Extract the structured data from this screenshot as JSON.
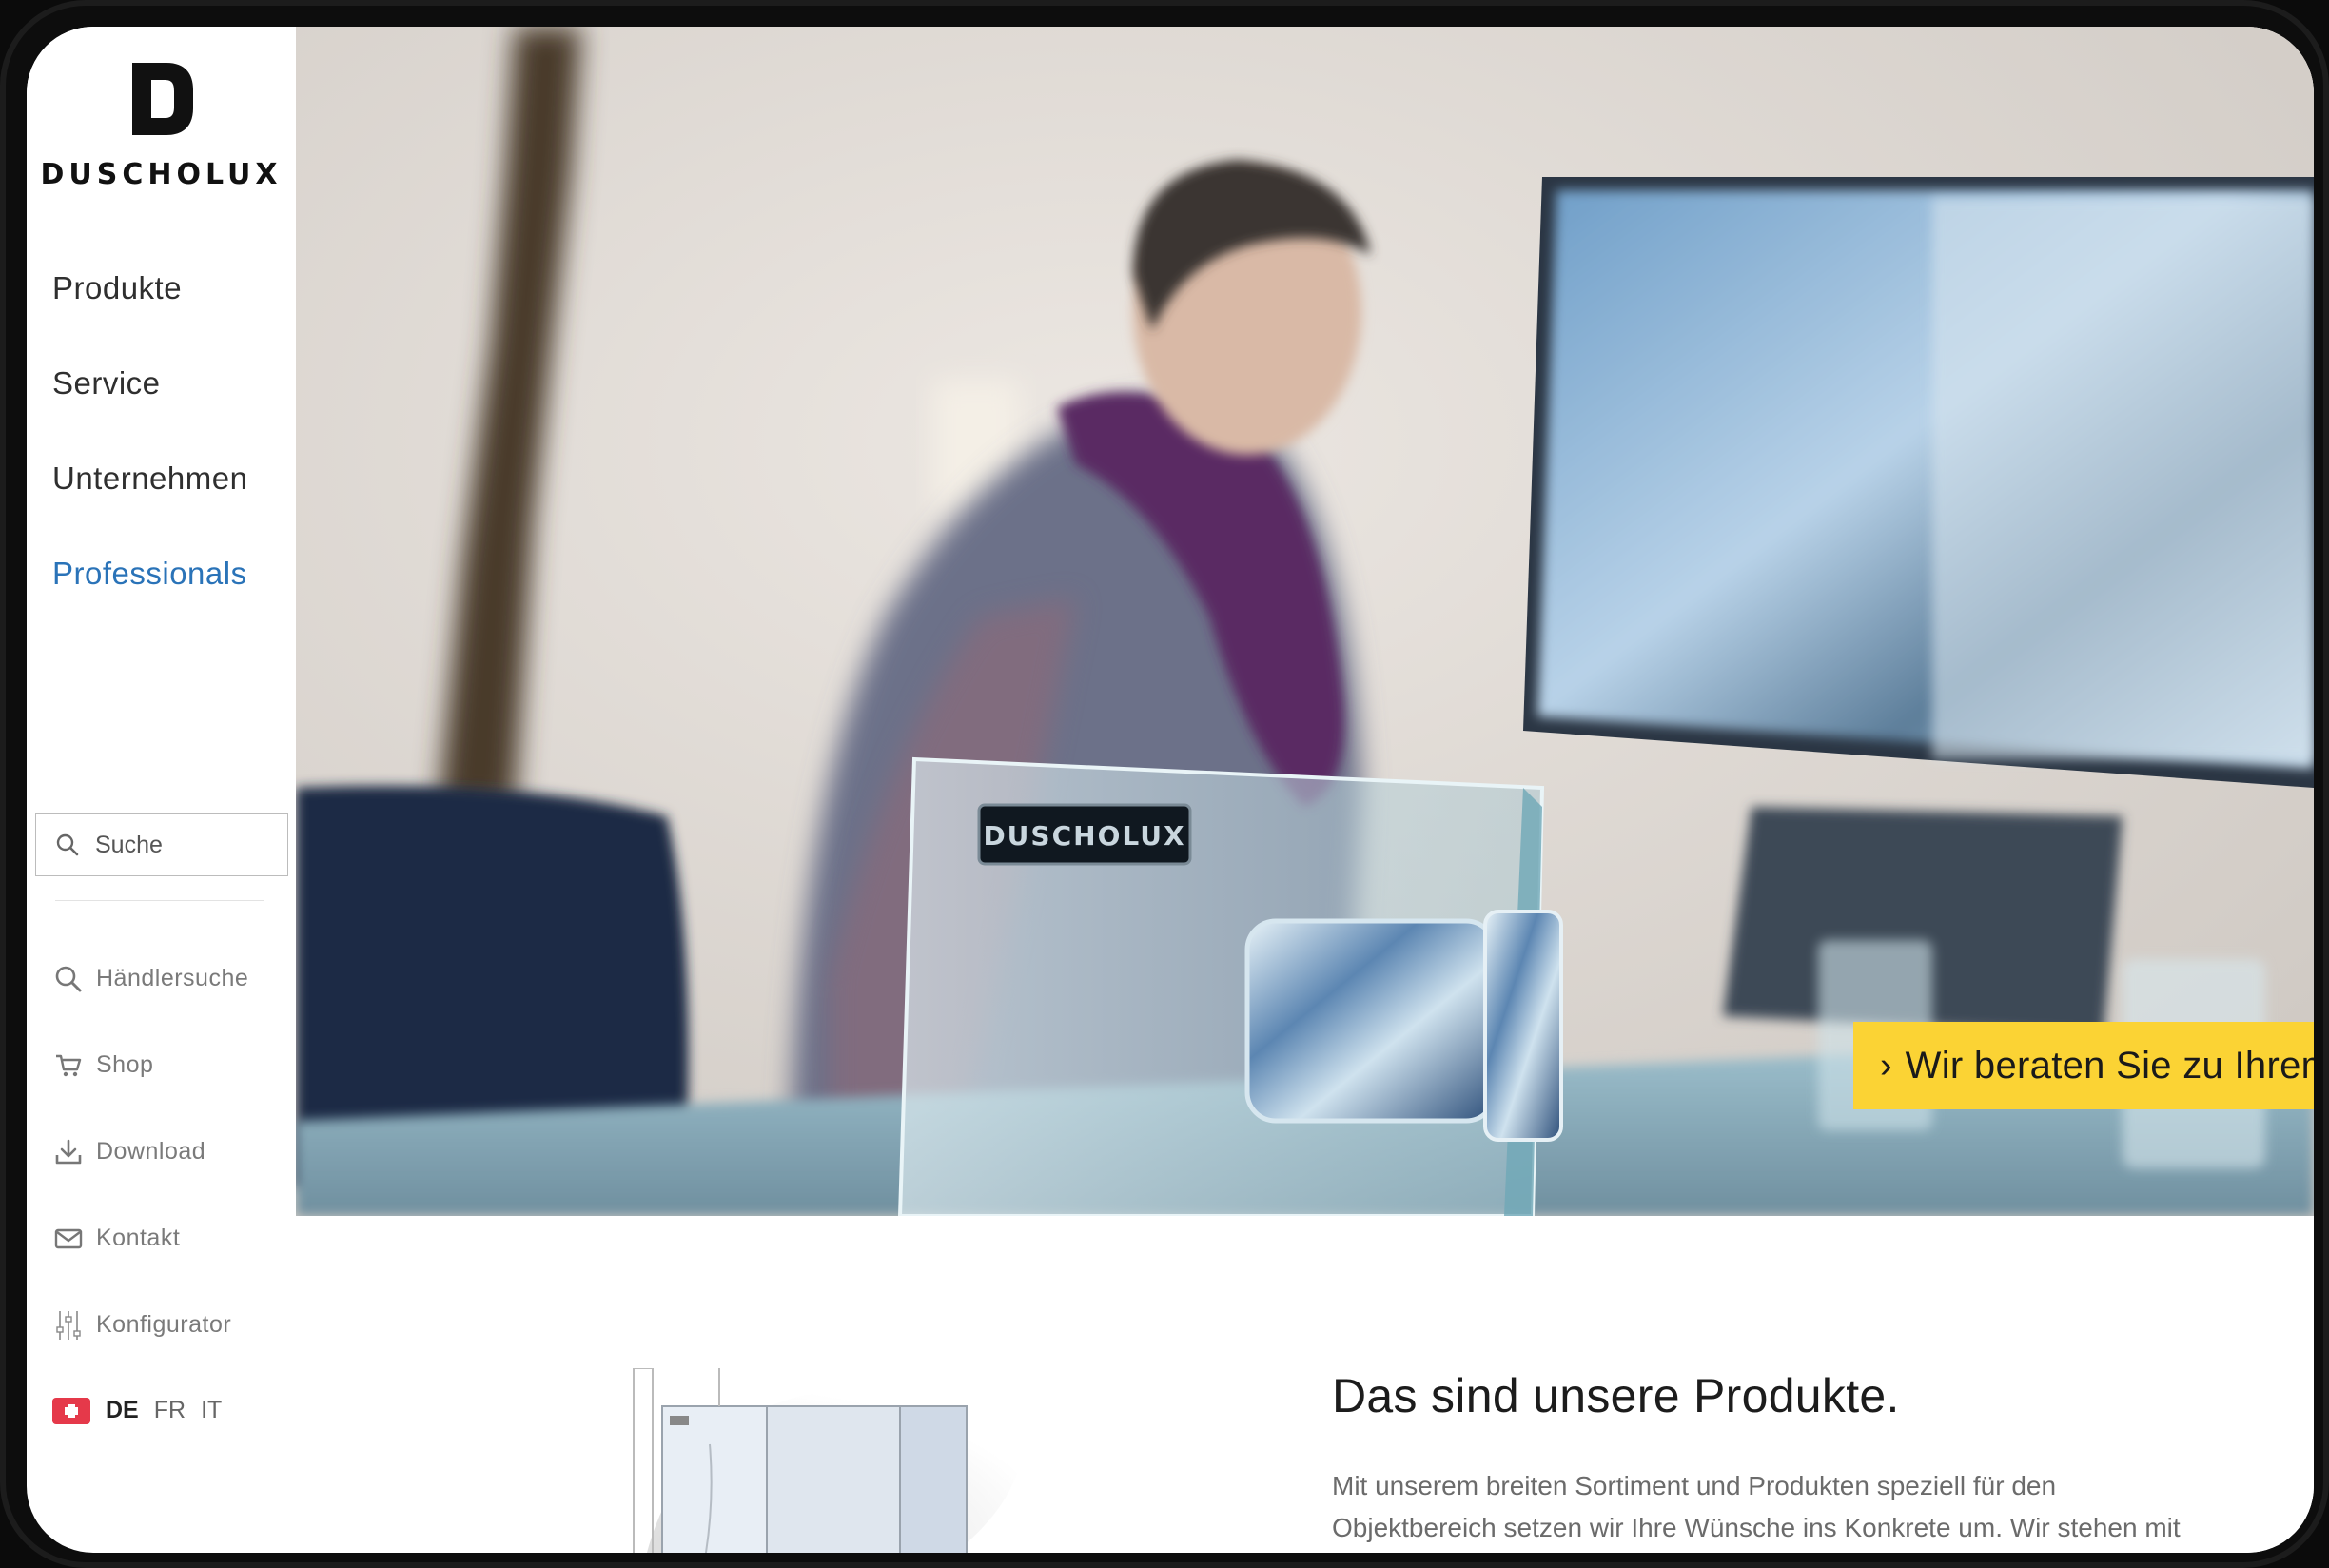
{
  "brand": {
    "name": "DUSCHOLUX",
    "logo_letter": "D"
  },
  "nav": {
    "items": [
      {
        "label": "Produkte",
        "active": false
      },
      {
        "label": "Service",
        "active": false
      },
      {
        "label": "Unternehmen",
        "active": false
      },
      {
        "label": "Professionals",
        "active": true
      }
    ]
  },
  "search": {
    "placeholder": "Suche",
    "icon": "search-icon"
  },
  "tools": [
    {
      "label": "Händlersuche",
      "icon": "search-icon"
    },
    {
      "label": "Shop",
      "icon": "cart-icon"
    },
    {
      "label": "Download",
      "icon": "download-icon"
    },
    {
      "label": "Kontakt",
      "icon": "mail-icon"
    },
    {
      "label": "Konfigurator",
      "icon": "sliders-icon"
    }
  ],
  "language": {
    "flag": "swiss-flag-icon",
    "options": [
      "DE",
      "FR",
      "IT"
    ],
    "selected": "DE"
  },
  "hero": {
    "cta_label": "Wir beraten Sie zu Ihrem Projekt",
    "cta_color": "#fbd334",
    "product_badge": "DUSCHOLUX"
  },
  "products": {
    "heading": "Das sind unsere Produkte.",
    "text": "Mit unserem breiten Sortiment und Produkten speziell für den Objektbereich setzen wir Ihre Wünsche ins Konkrete um. Wir stehen mit unseren Produkten für Ästhetik, Nachhaltigkeit und"
  },
  "colors": {
    "accent": "#2a73b8",
    "cta": "#fbd334",
    "flag": "#e5394a"
  }
}
